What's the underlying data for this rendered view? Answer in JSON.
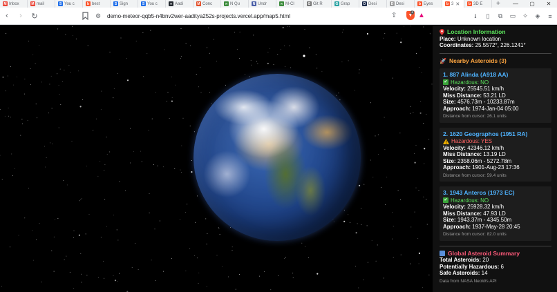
{
  "browser": {
    "tabs": [
      {
        "label": "Inbox",
        "icon": "gmail-icon",
        "color": "#ea4335",
        "glyph": "M"
      },
      {
        "label": "mail",
        "icon": "gmail-icon",
        "color": "#ea4335",
        "glyph": "M"
      },
      {
        "label": "You c",
        "icon": "s-icon",
        "color": "#1f6feb",
        "glyph": "S"
      },
      {
        "label": "best",
        "icon": "brave-icon",
        "color": "#fb542b",
        "glyph": "b"
      },
      {
        "label": "Sign",
        "icon": "s-icon",
        "color": "#1f6feb",
        "glyph": "S"
      },
      {
        "label": "You c",
        "icon": "s-icon",
        "color": "#1f6feb",
        "glyph": "S"
      },
      {
        "label": "Aadi",
        "icon": "github-icon",
        "color": "#24292f",
        "glyph": "●"
      },
      {
        "label": "Conc",
        "icon": "m-icon",
        "color": "#e34c26",
        "glyph": "M"
      },
      {
        "label": "N Qu",
        "icon": "copilot-icon",
        "color": "#3b8b3b",
        "glyph": "∞"
      },
      {
        "label": "Undr",
        "icon": "nn-icon",
        "color": "#4a5fa8",
        "glyph": "N"
      },
      {
        "label": "M-Cl",
        "icon": "copilot-icon",
        "color": "#3b8b3b",
        "glyph": "∞"
      },
      {
        "label": "Git R",
        "icon": "git-icon",
        "color": "#777",
        "glyph": "G"
      },
      {
        "label": "Grap",
        "icon": "graph-icon",
        "color": "#2aa3a3",
        "glyph": "G"
      },
      {
        "label": "Desi",
        "icon": "d-icon",
        "color": "#1b2a4a",
        "glyph": "D"
      },
      {
        "label": "Desi",
        "icon": "d-icon",
        "color": "#9a9a9a",
        "glyph": "D"
      },
      {
        "label": "Eyes",
        "icon": "brave-icon",
        "color": "#fb542b",
        "glyph": "b"
      },
      {
        "label": "3",
        "icon": "brave-icon",
        "color": "#fb542b",
        "glyph": "b",
        "active": true
      },
      {
        "label": "3D E",
        "icon": "brave-icon",
        "color": "#fb542b",
        "glyph": "b"
      }
    ],
    "url": "demo-meteor-qqb5-n4bnv2wer-aaditya252s-projects.vercel.app/map5.html",
    "shield_badge": "1"
  },
  "panel": {
    "location": {
      "title": "Location Information",
      "place_label": "Place:",
      "place_value": "Unknown location",
      "coords_label": "Coordinates:",
      "coords_value": "25.5572°, 226.1241°"
    },
    "nearby_title": "Nearby Asteroids (3)",
    "asteroids": [
      {
        "name": "1. 887 Alinda (A918 AA)",
        "hazard": "Hazardous: NO",
        "velocity": "25545.51 km/h",
        "miss": "53.21 LD",
        "size": "4576.73m - 10233.87m",
        "approach": "1974-Jan-04 05:00",
        "distance": "Distance from cursor: 26.1 units"
      },
      {
        "name": "2. 1620 Geographos (1951 RA)",
        "hazard": "Hazardous: YES",
        "velocity": "42346.12 km/h",
        "miss": "13.19 LD",
        "size": "2358.06m - 5272.78m",
        "approach": "1901-Aug-23 17:36",
        "distance": "Distance from cursor: 59.4 units"
      },
      {
        "name": "3. 1943 Anteros (1973 EC)",
        "hazard": "Hazardous: NO",
        "velocity": "25928.32 km/h",
        "miss": "47.93 LD",
        "size": "1943.37m - 4345.50m",
        "approach": "1937-May-28 20:45",
        "distance": "Distance from cursor: 82.0 units"
      }
    ],
    "labels": {
      "velocity": "Velocity:",
      "miss": "Miss Distance:",
      "size": "Size:",
      "approach": "Approach:"
    },
    "summary": {
      "title": "Global Asteroid Summary",
      "total_label": "Total Asteroids:",
      "total_value": "20",
      "hazard_label": "Potentially Hazardous:",
      "hazard_value": "6",
      "safe_label": "Safe Asteroids:",
      "safe_value": "14",
      "source": "Data from NASA NeoWs API"
    }
  }
}
